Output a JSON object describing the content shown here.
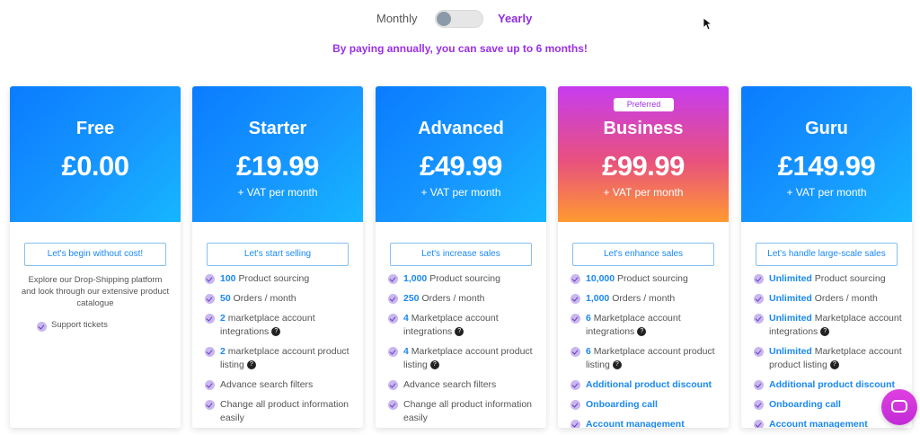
{
  "billing": {
    "monthly_label": "Monthly",
    "yearly_label": "Yearly",
    "selected": "monthly"
  },
  "promo": "By paying annually, you can save up to 6 months!",
  "plans": [
    {
      "name": "Free",
      "price": "£0.00",
      "vat": "",
      "cta": "Let's begin without cost!",
      "description": "Explore our Drop-Shipping platform and look through our extensive product catalogue",
      "features": [
        {
          "text": "Support tickets"
        }
      ]
    },
    {
      "name": "Starter",
      "price": "£19.99",
      "vat": "+ VAT per month",
      "cta": "Let's start selling",
      "features": [
        {
          "num": "100",
          "text": " Product sourcing"
        },
        {
          "num": "50",
          "text": " Orders / month"
        },
        {
          "num": "2",
          "text": " marketplace account integrations"
        },
        {
          "num": "2",
          "text": " marketplace account product listing"
        },
        {
          "text": "Advance search filters"
        },
        {
          "text": "Change all product information easily"
        }
      ]
    },
    {
      "name": "Advanced",
      "price": "£49.99",
      "vat": "+ VAT per month",
      "cta": "Let's increase sales",
      "features": [
        {
          "num": "1,000",
          "text": " Product sourcing"
        },
        {
          "num": "250",
          "text": " Orders / month"
        },
        {
          "num": "4",
          "text": " Marketplace account integrations"
        },
        {
          "num": "4",
          "text": " Marketplace account product listing"
        },
        {
          "text": "Advance search filters"
        },
        {
          "text": "Change all product information easily"
        }
      ]
    },
    {
      "name": "Business",
      "price": "£99.99",
      "vat": "+ VAT per month",
      "badge": "Preferred",
      "cta": "Let's enhance sales",
      "features": [
        {
          "num": "10,000",
          "text": " Product sourcing"
        },
        {
          "num": "1,000",
          "text": " Orders / month"
        },
        {
          "num": "6",
          "text": " Marketplace account integrations"
        },
        {
          "num": "6",
          "text": " Marketplace account product listing"
        },
        {
          "hl": "Additional product discount"
        },
        {
          "hl": "Onboarding call"
        },
        {
          "hl": "Account management"
        }
      ]
    },
    {
      "name": "Guru",
      "price": "£149.99",
      "vat": "+ VAT per month",
      "cta": "Let's handle large-scale sales",
      "features": [
        {
          "num": "Unlimited",
          "text": " Product sourcing"
        },
        {
          "num": "Unlimited",
          "text": " Orders / month"
        },
        {
          "num": "Unlimited",
          "text": " Marketplace account integrations"
        },
        {
          "num": "Unlimited",
          "text": " Marketplace account product listing"
        },
        {
          "hl": "Additional product discount"
        },
        {
          "hl": "Onboarding call"
        },
        {
          "hl": "Account management"
        }
      ]
    }
  ],
  "help_icon": "?",
  "icons": {
    "feature": "check-icon",
    "help": "help-icon",
    "chat": "chat-icon"
  },
  "colors": {
    "accent_blue": "#1a88f2",
    "accent_purple": "#9b30e6"
  }
}
